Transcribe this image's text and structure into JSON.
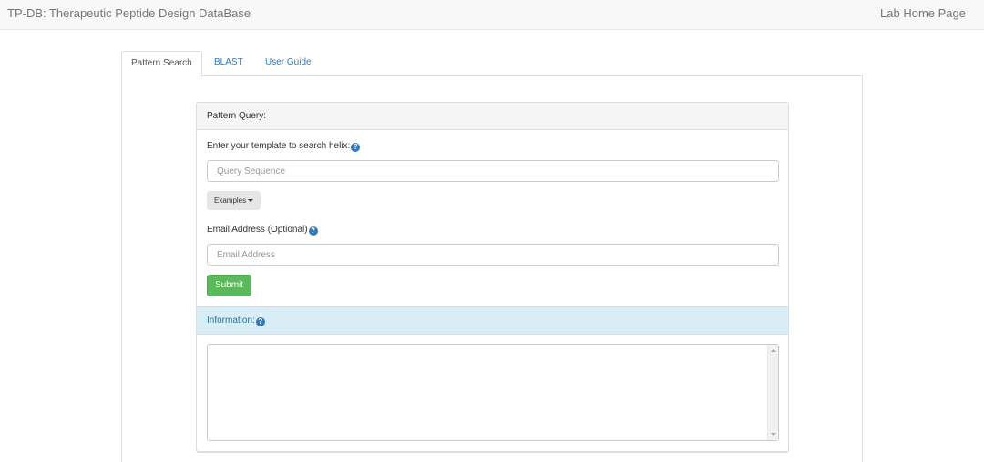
{
  "navbar": {
    "brand": "TP-DB: Therapeutic Peptide Design DataBase",
    "home_link": "Lab Home Page"
  },
  "tabs": [
    {
      "label": "Pattern Search",
      "active": true
    },
    {
      "label": "BLAST",
      "active": false
    },
    {
      "label": "User Guide",
      "active": false
    }
  ],
  "pattern_panel": {
    "heading": "Pattern Query:",
    "template_label": "Enter your template to search helix:",
    "query_placeholder": "Query Sequence",
    "examples_label": "Examples",
    "email_label": "Email Address (Optional)",
    "email_placeholder": "Email Address",
    "submit_label": "Submit"
  },
  "info_panel": {
    "heading": "Information:"
  },
  "icons": {
    "help": "question-circle-icon",
    "caret": "caret-down-icon"
  },
  "colors": {
    "link": "#337ab7",
    "submit": "#5cb85c",
    "info_bg": "#d9edf7",
    "info_text": "#31708f"
  }
}
